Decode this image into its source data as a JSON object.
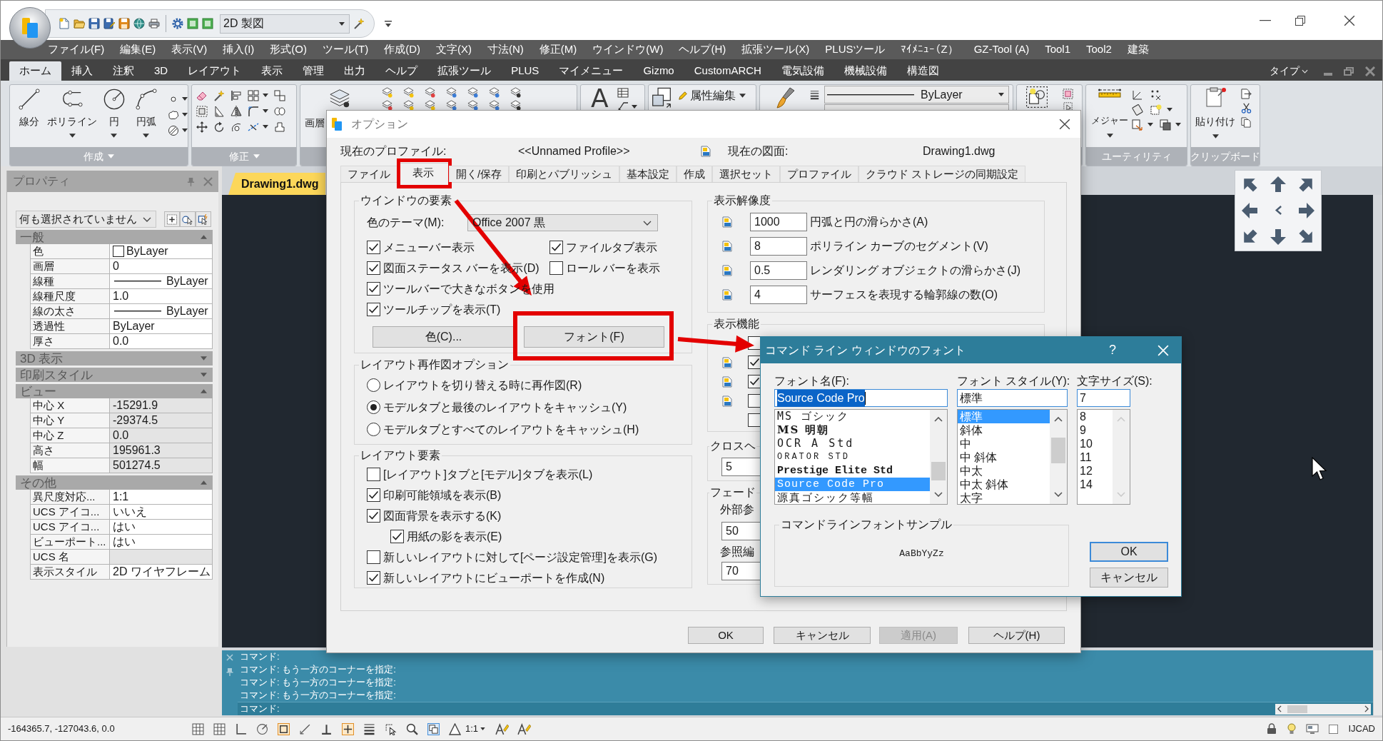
{
  "title_bar": {
    "workspace": "2D 製図"
  },
  "menu_bar": [
    "ファイル(F)",
    "編集(E)",
    "表示(V)",
    "挿入(I)",
    "形式(O)",
    "ツール(T)",
    "作成(D)",
    "文字(X)",
    "寸法(N)",
    "修正(M)",
    "ウインドウ(W)",
    "ヘルプ(H)",
    "拡張ツール(X)",
    "PLUSツール",
    "ﾏｲﾒﾆｭｰ（Z）",
    "GZ-Tool (A)",
    "Tool1",
    "Tool2",
    "建築"
  ],
  "ribbon": {
    "tabs": [
      {
        "label": "ホーム",
        "selected": true
      },
      {
        "label": "挿入",
        "selected": false
      },
      {
        "label": "注釈",
        "selected": false
      },
      {
        "label": "3D",
        "selected": false
      },
      {
        "label": "レイアウト",
        "selected": false
      },
      {
        "label": "表示",
        "selected": false
      },
      {
        "label": "管理",
        "selected": false
      },
      {
        "label": "出力",
        "selected": false
      },
      {
        "label": "ヘルプ",
        "selected": false
      },
      {
        "label": "拡張ツール",
        "selected": false
      },
      {
        "label": "PLUS",
        "selected": false
      },
      {
        "label": "マイメニュー",
        "selected": false
      },
      {
        "label": "Gizmo",
        "selected": false
      },
      {
        "label": "CustomARCH",
        "selected": false
      },
      {
        "label": "電気設備",
        "selected": false
      },
      {
        "label": "機械設備",
        "selected": false
      },
      {
        "label": "構造図",
        "selected": false
      }
    ],
    "search_label": "タイプ",
    "panels": [
      {
        "kind": "draw",
        "title": "作成",
        "expander": true,
        "buttons": [
          {
            "label": "線分",
            "dropdown": false
          },
          {
            "label": "ポリライン",
            "dropdown": true
          },
          {
            "label": "円",
            "dropdown": true
          },
          {
            "label": "円弧",
            "dropdown": true
          }
        ]
      },
      {
        "kind": "modify",
        "title": "修正",
        "expander": true
      },
      {
        "kind": "layers",
        "buttons": [
          {
            "label": "画層",
            "dropdown": false
          }
        ]
      },
      {
        "kind": "annotation",
        "buttons": [
          {
            "label": "A",
            "dropdown": false
          }
        ]
      },
      {
        "kind": "block",
        "buttons": [
          {
            "label": "属性編集",
            "dropdown": true
          }
        ]
      },
      {
        "kind": "properties",
        "combo": "ByLayer"
      },
      {
        "kind": "groups"
      },
      {
        "kind": "utilities",
        "title": "ユーティリティ",
        "expander": false,
        "buttons": [
          {
            "label": "メジャー",
            "dropdown": true
          }
        ]
      },
      {
        "kind": "clipboard",
        "title": "クリップボード",
        "expander": false,
        "buttons": [
          {
            "label": "貼り付け",
            "dropdown": true
          }
        ]
      }
    ]
  },
  "properties_palette": {
    "title": "プロパティ",
    "selection": "何も選択されていません",
    "sections": [
      {
        "title": "一般",
        "expanded": true,
        "rows": [
          {
            "kind": "color",
            "label": "色",
            "value": "ByLayer",
            "read_only": false
          },
          {
            "kind": "text",
            "label": "画層",
            "value": "0",
            "read_only": false
          },
          {
            "kind": "line",
            "label": "線種",
            "value": "ByLayer",
            "read_only": false
          },
          {
            "kind": "text",
            "label": "線種尺度",
            "value": "1.0",
            "read_only": false
          },
          {
            "kind": "line",
            "label": "線の太さ",
            "value": "ByLayer",
            "read_only": false
          },
          {
            "kind": "text",
            "label": "透過性",
            "value": "ByLayer",
            "read_only": false
          },
          {
            "kind": "text",
            "label": "厚さ",
            "value": "0.0",
            "read_only": false
          }
        ]
      },
      {
        "title": "3D 表示",
        "expanded": false
      },
      {
        "title": "印刷スタイル",
        "expanded": false
      },
      {
        "title": "ビュー",
        "expanded": true,
        "rows": [
          {
            "kind": "text",
            "label": "中心 X",
            "value": "-15291.9",
            "read_only": true
          },
          {
            "kind": "text",
            "label": "中心 Y",
            "value": "-29374.5",
            "read_only": true
          },
          {
            "kind": "text",
            "label": "中心 Z",
            "value": "0.0",
            "read_only": true
          },
          {
            "kind": "text",
            "label": "高さ",
            "value": "195961.3",
            "read_only": true
          },
          {
            "kind": "text",
            "label": "幅",
            "value": "501274.5",
            "read_only": true
          }
        ]
      },
      {
        "title": "その他",
        "expanded": true,
        "rows": [
          {
            "kind": "text",
            "label": "異尺度対応...",
            "value": "1:1",
            "read_only": false
          },
          {
            "kind": "text",
            "label": "UCS アイコ...",
            "value": "いいえ",
            "read_only": false
          },
          {
            "kind": "text",
            "label": "UCS アイコ...",
            "value": "はい",
            "read_only": false
          },
          {
            "kind": "text",
            "label": "ビューポート...",
            "value": "はい",
            "read_only": false
          },
          {
            "kind": "text",
            "label": "UCS 名",
            "read_only": true
          },
          {
            "kind": "text",
            "label": "表示スタイル",
            "value": "2D ワイヤフレーム",
            "read_only": false
          }
        ]
      }
    ]
  },
  "drawing_tab": {
    "label": "Drawing1.dwg"
  },
  "command_line": {
    "history": [
      "コマンド:",
      "コマンド: もう一方のコーナーを指定:",
      "コマンド: もう一方のコーナーを指定:",
      "コマンド: もう一方のコーナーを指定:"
    ],
    "prompt": "コマンド:"
  },
  "status_bar": {
    "coordinates": "-164365.7, -127043.6, 0.0",
    "scale": "1:1",
    "product": "IJCAD"
  },
  "options_dialog": {
    "title": "オプション",
    "profile_label": "現在のプロファイル:",
    "profile": "<<Unnamed Profile>>",
    "drawing_label": "現在の図面:",
    "drawing": "Drawing1.dwg",
    "tabs": [
      {
        "label": "ファイル",
        "selected": false,
        "highlighted": false
      },
      {
        "label": "表示",
        "selected": true,
        "highlighted": true
      },
      {
        "label": "開く/保存",
        "selected": false,
        "highlighted": false
      },
      {
        "label": "印刷とパブリッシュ",
        "selected": false,
        "highlighted": false
      },
      {
        "label": "基本設定",
        "selected": false,
        "highlighted": false
      },
      {
        "label": "作成",
        "selected": false,
        "highlighted": false
      },
      {
        "label": "選択セット",
        "selected": false,
        "highlighted": false
      },
      {
        "label": "プロファイル",
        "selected": false,
        "highlighted": false
      },
      {
        "label": "クラウド ストレージの同期設定",
        "selected": false,
        "highlighted": false
      }
    ],
    "window_elements": {
      "title": "ウインドウの要素",
      "theme_label": "色のテーマ(M):",
      "theme": "Office 2007 黒",
      "checkboxes": [
        {
          "label": "メニューバー表示",
          "checked": true
        },
        {
          "label": "ファイルタブ表示",
          "checked": true
        },
        {
          "label": "図面ステータス バーを表示(D)",
          "checked": true
        },
        {
          "label": "ロール バーを表示",
          "checked": false
        },
        {
          "label": "ツールバーで大きなボタンを使用",
          "checked": true
        },
        {
          "label": "ツールチップを表示(T)",
          "checked": true
        }
      ],
      "buttons": [
        {
          "label": "色(C)...",
          "highlighted": false
        },
        {
          "label": "フォント(F)",
          "highlighted": true
        }
      ]
    },
    "layout_regen": {
      "title": "レイアウト再作図オプション",
      "options": [
        {
          "label": "レイアウトを切り替える時に再作図(R)",
          "selected": false
        },
        {
          "label": "モデルタブと最後のレイアウトをキャッシュ(Y)",
          "selected": true
        },
        {
          "label": "モデルタブとすべてのレイアウトをキャッシュ(H)",
          "selected": false
        }
      ]
    },
    "layout_elements": {
      "title": "レイアウト要素",
      "checkboxes": [
        {
          "label": "[レイアウト]タブと[モデル]タブを表示(L)",
          "checked": false
        },
        {
          "label": "印刷可能領域を表示(B)",
          "checked": true
        },
        {
          "label": "図面背景を表示する(K)",
          "checked": true,
          "children": [
            {
              "label": "用紙の影を表示(E)",
              "checked": true
            }
          ]
        },
        {
          "label": "新しいレイアウトに対して[ページ設定管理]を表示(G)",
          "checked": false
        },
        {
          "label": "新しいレイアウトにビューポートを作成(N)",
          "checked": true
        }
      ]
    },
    "display_resolution": {
      "title": "表示解像度",
      "rows": [
        {
          "value": "1000",
          "label": "円弧と円の滑らかさ(A)"
        },
        {
          "value": "8",
          "label": "ポリライン カーブのセグメント(V)"
        },
        {
          "value": "0.5",
          "label": "レンダリング オブジェクトの滑らかさ(J)"
        },
        {
          "value": "4",
          "label": "サーフェスを表現する輪郭線の数(O)"
        }
      ]
    },
    "display_features": {
      "title": "表示機能",
      "rows": [
        {
          "checked": false,
          "drawing_icon": false
        },
        {
          "checked": true,
          "drawing_icon": true
        },
        {
          "checked": true,
          "drawing_icon": true
        },
        {
          "checked": false,
          "drawing_icon": true
        },
        {
          "checked": false,
          "drawing_icon": false
        }
      ]
    },
    "crosshair": {
      "title": "クロスヘ",
      "value": "5"
    },
    "fade": {
      "title": "フェード",
      "rows": [
        {
          "label": "外部参",
          "value": "50"
        },
        {
          "label": "参照編",
          "value": "70"
        }
      ]
    },
    "buttons": [
      {
        "label": "OK",
        "disabled": false
      },
      {
        "label": "キャンセル",
        "disabled": false
      },
      {
        "label": "適用(A)",
        "disabled": true
      },
      {
        "label": "ヘルプ(H)",
        "disabled": false
      }
    ]
  },
  "font_dialog": {
    "title": "コマンド ライン ウィンドウのフォント",
    "help": "?",
    "font_name": {
      "label": "フォント名(F):",
      "value": "Source Code Pro",
      "items": [
        {
          "label": "MS ゴシック",
          "kind": "gothic",
          "selected": false
        },
        {
          "label": "MS 明朝",
          "kind": "mincho",
          "selected": false
        },
        {
          "label": "OCR A Std",
          "kind": "ocr",
          "selected": false
        },
        {
          "label": "ORATOR STD",
          "kind": "orator",
          "selected": false
        },
        {
          "label": "Prestige Elite Std",
          "kind": "prestige",
          "selected": false
        },
        {
          "label": "Source Code Pro",
          "kind": "code",
          "selected": true
        },
        {
          "label": "源真ゴシック等幅",
          "kind": "gothic",
          "selected": false
        }
      ]
    },
    "font_style": {
      "label": "フォント スタイル(Y):",
      "value": "標準",
      "items": [
        {
          "label": "標準",
          "selected": true
        },
        {
          "label": "斜体",
          "selected": false
        },
        {
          "label": "中",
          "selected": false
        },
        {
          "label": "中 斜体",
          "selected": false
        },
        {
          "label": "中太",
          "selected": false
        },
        {
          "label": "中太 斜体",
          "selected": false
        },
        {
          "label": "太字",
          "selected": false
        }
      ]
    },
    "font_size": {
      "label": "文字サイズ(S):",
      "value": "7",
      "items": [
        {
          "label": "8",
          "selected": false
        },
        {
          "label": "9",
          "selected": false
        },
        {
          "label": "10",
          "selected": false
        },
        {
          "label": "11",
          "selected": false
        },
        {
          "label": "12",
          "selected": false
        },
        {
          "label": "14",
          "selected": false
        }
      ]
    },
    "sample": {
      "title": "コマンドラインフォントサンプル",
      "text": "AaBbYyZz"
    },
    "buttons": [
      {
        "label": "OK",
        "default": true
      },
      {
        "label": "キャンセル",
        "default": false
      }
    ]
  }
}
